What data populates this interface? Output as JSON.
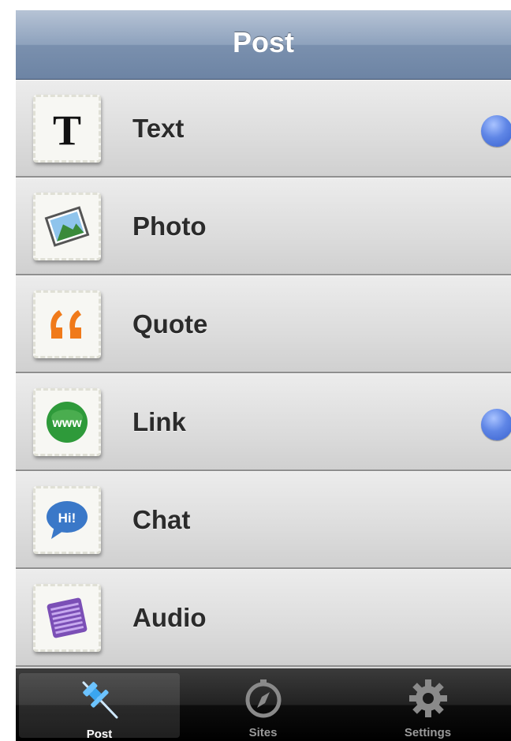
{
  "navbar": {
    "title": "Post"
  },
  "items": [
    {
      "label": "Text",
      "icon": "text-icon",
      "indicator": true
    },
    {
      "label": "Photo",
      "icon": "photo-icon",
      "indicator": false
    },
    {
      "label": "Quote",
      "icon": "quote-icon",
      "indicator": false
    },
    {
      "label": "Link",
      "icon": "link-icon",
      "indicator": true
    },
    {
      "label": "Chat",
      "icon": "chat-icon",
      "indicator": false
    },
    {
      "label": "Audio",
      "icon": "audio-icon",
      "indicator": false
    }
  ],
  "tabs": [
    {
      "label": "Post",
      "icon": "pushpin-icon",
      "active": true
    },
    {
      "label": "Sites",
      "icon": "compass-icon",
      "active": false
    },
    {
      "label": "Settings",
      "icon": "gear-icon",
      "active": false
    }
  ],
  "icon_text": {
    "link": "www",
    "chat": "Hi!"
  },
  "colors": {
    "navbar": "#7a90ae",
    "indicator": "#5f86e6",
    "tabbar": "#000000",
    "quote": "#f07a1a",
    "link": "#2e9a3a",
    "chat": "#3a78c8",
    "audio": "#7b4fb6"
  }
}
